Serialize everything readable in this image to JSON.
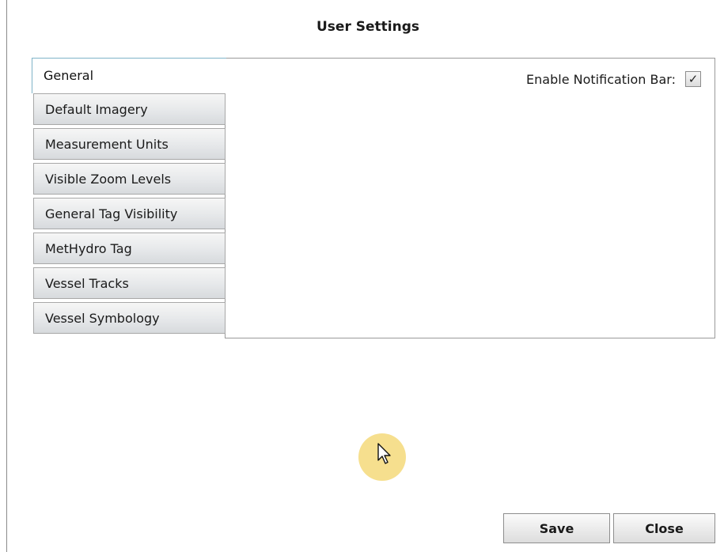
{
  "dialog": {
    "title": "User Settings"
  },
  "tabs": [
    {
      "label": "General",
      "active": true
    },
    {
      "label": "Default Imagery",
      "active": false
    },
    {
      "label": "Measurement Units",
      "active": false
    },
    {
      "label": "Visible Zoom Levels",
      "active": false
    },
    {
      "label": "General Tag Visibility",
      "active": false
    },
    {
      "label": "MetHydro Tag",
      "active": false
    },
    {
      "label": "Vessel Tracks",
      "active": false
    },
    {
      "label": "Vessel Symbology",
      "active": false
    }
  ],
  "general": {
    "notification_label": "Enable Notification Bar:",
    "notification_checked": true,
    "check_glyph": "✓"
  },
  "footer": {
    "save_label": "Save",
    "close_label": "Close"
  },
  "icons": {
    "cursor": "mouse-pointer-icon"
  },
  "colors": {
    "active_tab_border": "#7fb3c8",
    "cursor_highlight": "#f5dc82"
  }
}
